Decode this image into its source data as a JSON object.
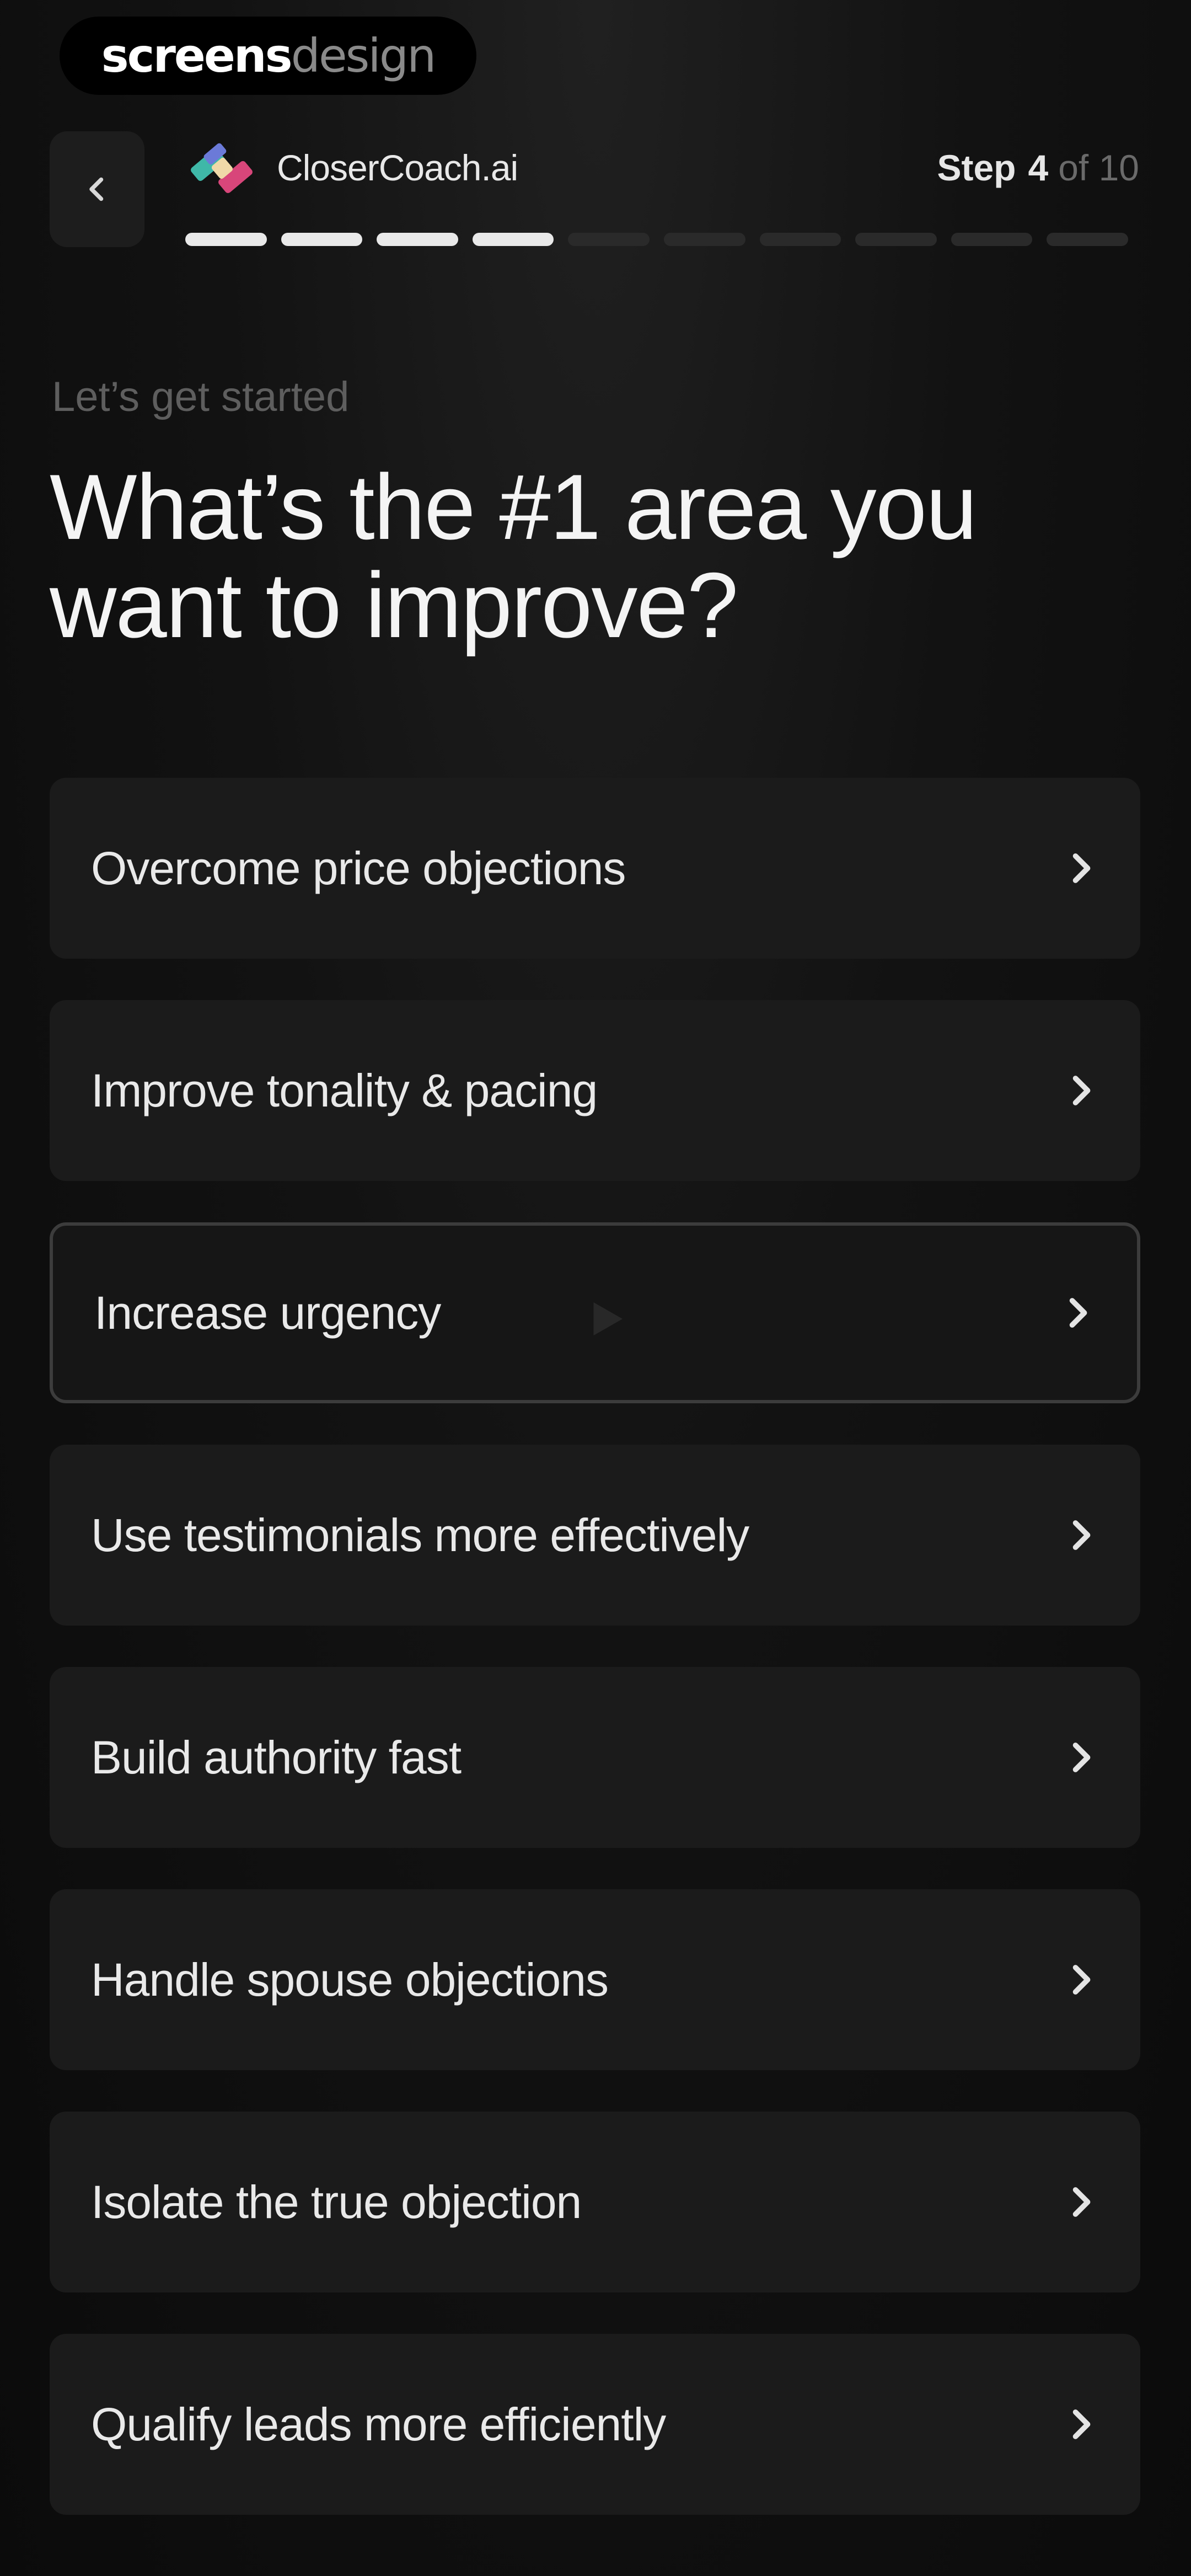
{
  "watermark": {
    "part1": "screens",
    "part2": "design"
  },
  "header": {
    "brand": "CloserCoach.ai",
    "step_label": "Step",
    "step_current": "4",
    "step_total": "of 10",
    "progress": {
      "completed": 4,
      "total": 10
    }
  },
  "intro": {
    "eyebrow": "Let’s get started",
    "title": "What’s the #1 area you want to improve?"
  },
  "options": [
    {
      "label": "Overcome price objections",
      "selected": false
    },
    {
      "label": "Improve tonality & pacing",
      "selected": false
    },
    {
      "label": "Increase urgency",
      "selected": true
    },
    {
      "label": "Use testimonials more effectively",
      "selected": false
    },
    {
      "label": "Build authority fast",
      "selected": false
    },
    {
      "label": "Handle spouse objections",
      "selected": false
    },
    {
      "label": "Isolate the true objection",
      "selected": false
    },
    {
      "label": "Qualify leads more efficiently",
      "selected": false
    }
  ],
  "icons": {
    "back": "chevron-left-icon",
    "option_arrow": "chevron-right-icon",
    "brand_logo": "closercoach-logo"
  },
  "colors": {
    "background": "#0c0c0c",
    "card": "#1b1b1b",
    "selected_border": "#3c3c3c",
    "progress_done": "#e9e9e9",
    "progress_todo": "#2a2a2a",
    "logo_teal": "#3fb8a8",
    "logo_pink": "#d8467a"
  }
}
